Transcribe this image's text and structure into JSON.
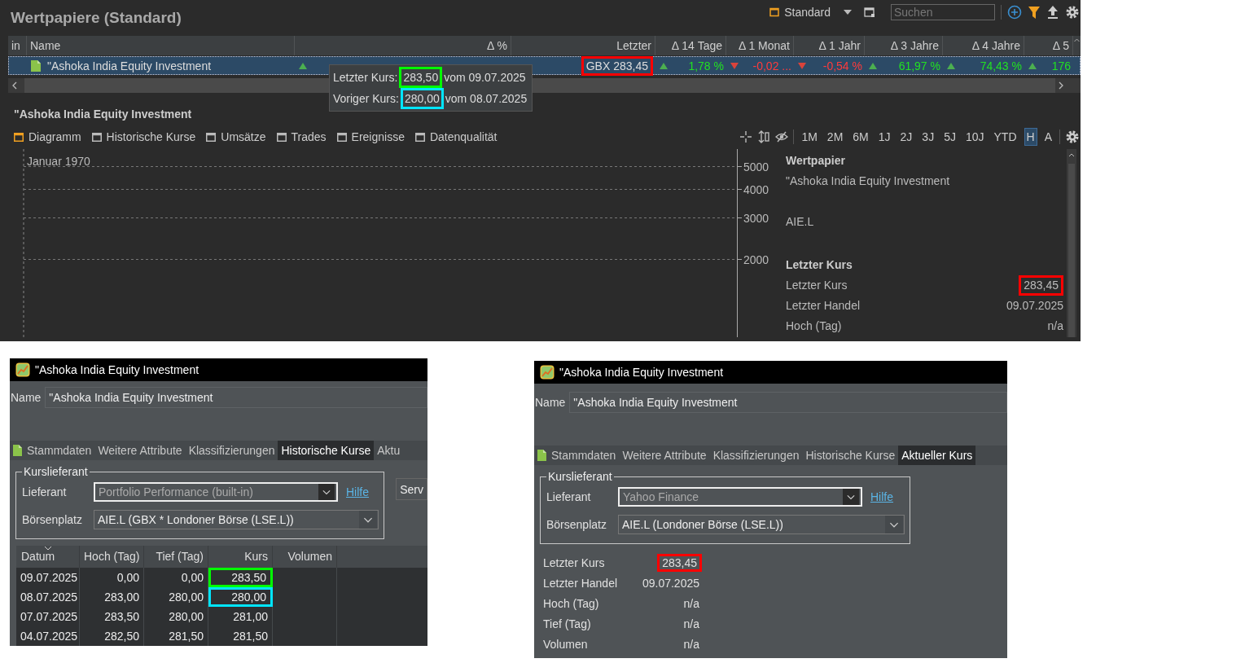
{
  "main": {
    "title": "Wertpapiere (Standard)",
    "view": "Standard",
    "search": {
      "placeholder": "Suchen"
    },
    "columns": [
      {
        "label": "in"
      },
      {
        "label": "Name"
      },
      {
        "label": "Δ %"
      },
      {
        "label": "Letzter"
      },
      {
        "label": "Δ 14 Tage"
      },
      {
        "label": "Δ 1 Monat"
      },
      {
        "label": "Δ 1 Jahr"
      },
      {
        "label": "Δ 3 Jahre"
      },
      {
        "label": "Δ 4 Jahre"
      },
      {
        "label": "Δ 5"
      }
    ],
    "rows": [
      {
        "selected": true,
        "cells": [
          {
            "kind": "blank"
          },
          {
            "kind": "name",
            "text": "\"Ashoka India Equity Investment"
          },
          {
            "kind": "change",
            "rising": true
          },
          {
            "kind": "price",
            "text": "GBX 283,45",
            "color": "#ff0000"
          },
          {
            "kind": "change",
            "rising": true,
            "text": "1,78 %"
          },
          {
            "kind": "change",
            "rising": false,
            "text": "-0,02 ..."
          },
          {
            "kind": "change",
            "rising": false,
            "text": "-0,54 %"
          },
          {
            "kind": "change",
            "rising": true,
            "text": "61,97 %"
          },
          {
            "kind": "change",
            "rising": true,
            "text": "74,43 %"
          },
          {
            "kind": "change",
            "rising": true,
            "text": "176"
          }
        ]
      }
    ],
    "tooltip": [
      {
        "label": "Letzter Kurs:",
        "value": "283,50",
        "suffix": "vom 09.07.2025",
        "color": "#00ff00"
      },
      {
        "label": "Voriger Kurs:",
        "value": "280,00",
        "suffix": "vom 08.07.2025",
        "color": "#00e5ff"
      }
    ]
  },
  "detail": {
    "title": "\"Ashoka India Equity Investment",
    "tabs": [
      {
        "label": "Diagramm",
        "selected": true
      },
      {
        "label": "Historische Kurse",
        "selected": false
      },
      {
        "label": "Umsätze",
        "selected": false
      },
      {
        "label": "Trades",
        "selected": false
      },
      {
        "label": "Ereignisse",
        "selected": false
      },
      {
        "label": "Datenqualität",
        "selected": false
      }
    ],
    "periods": [
      {
        "label": "1M",
        "selected": false
      },
      {
        "label": "2M",
        "selected": false
      },
      {
        "label": "6M",
        "selected": false
      },
      {
        "label": "1J",
        "selected": false
      },
      {
        "label": "2J",
        "selected": false
      },
      {
        "label": "3J",
        "selected": false
      },
      {
        "label": "5J",
        "selected": false
      },
      {
        "label": "10J",
        "selected": false
      },
      {
        "label": "YTD",
        "selected": false
      },
      {
        "label": "H",
        "selected": true
      },
      {
        "label": "A",
        "selected": false
      }
    ],
    "chart": {
      "date_label": "Januar 1970",
      "y_ticks": [
        "5000",
        "4000",
        "3000",
        "2000"
      ]
    },
    "info": [
      {
        "heading": "Wertpapier",
        "rows": [
          {
            "label": "\"Ashoka India Equity Investment"
          },
          {
            "label": "AIE.L",
            "gap_before": true
          }
        ]
      },
      {
        "heading": "Letzter Kurs",
        "rows": [
          {
            "label": "Letzter Kurs",
            "value": "283,45",
            "color": "#ff0000"
          },
          {
            "label": "Letzter Handel",
            "value": "09.07.2025"
          },
          {
            "label": "Hoch (Tag)",
            "value": "n/a"
          }
        ]
      }
    ]
  },
  "windows": [
    {
      "kind": "history",
      "title": "\"Ashoka India Equity Investment",
      "name_label": "Name",
      "name": "\"Ashoka India Equity Investment",
      "tabs": [
        {
          "label": "Stammdaten",
          "selected": false
        },
        {
          "label": "Weitere Attribute",
          "selected": false
        },
        {
          "label": "Klassifizierungen",
          "selected": false
        },
        {
          "label": "Historische Kurse",
          "selected": true
        },
        {
          "label": "Aktu",
          "selected": false
        }
      ],
      "group": "Kurslieferant",
      "fields": [
        {
          "label": "Lieferant",
          "value": "Portfolio Performance (built-in)"
        },
        {
          "label": "Börsenplatz",
          "value": "AIE.L (GBX * Londoner Börse (LSE.L))"
        }
      ],
      "help": "Hilfe",
      "side_button": "Serv",
      "table": {
        "columns": [
          "Datum",
          "Hoch (Tag)",
          "Tief (Tag)",
          "Kurs",
          "Volumen"
        ],
        "rows": [
          {
            "cells": [
              "09.07.2025",
              "0,00",
              "0,00",
              "283,50"
            ],
            "color": "#00ff00"
          },
          {
            "cells": [
              "08.07.2025",
              "283,00",
              "280,00",
              "280,00"
            ],
            "color": "#00e5ff"
          },
          {
            "cells": [
              "07.07.2025",
              "283,50",
              "280,00",
              "281,00"
            ]
          },
          {
            "cells": [
              "04.07.2025",
              "282,50",
              "281,50",
              "281,50"
            ]
          }
        ]
      }
    },
    {
      "kind": "quote",
      "title": "\"Ashoka India Equity Investment",
      "name_label": "Name",
      "name": "\"Ashoka India Equity Investment",
      "tabs": [
        {
          "label": "Stammdaten",
          "selected": false
        },
        {
          "label": "Weitere Attribute",
          "selected": false
        },
        {
          "label": "Klassifizierungen",
          "selected": false
        },
        {
          "label": "Historische Kurse",
          "selected": false
        },
        {
          "label": "Aktueller Kurs",
          "selected": true
        }
      ],
      "group": "Kurslieferant",
      "fields": [
        {
          "label": "Lieferant",
          "value": "Yahoo Finance"
        },
        {
          "label": "Börsenplatz",
          "value": "AIE.L (Londoner Börse (LSE.L))"
        }
      ],
      "help": "Hilfe",
      "quote": [
        {
          "label": "Letzter Kurs",
          "value": "283,45",
          "color": "#ff0000"
        },
        {
          "label": "Letzter Handel",
          "value": "09.07.2025"
        },
        {
          "label": "Hoch (Tag)",
          "value": "n/a"
        },
        {
          "label": "Tief (Tag)",
          "value": "n/a"
        },
        {
          "label": "Volumen",
          "value": "n/a"
        }
      ]
    }
  ]
}
